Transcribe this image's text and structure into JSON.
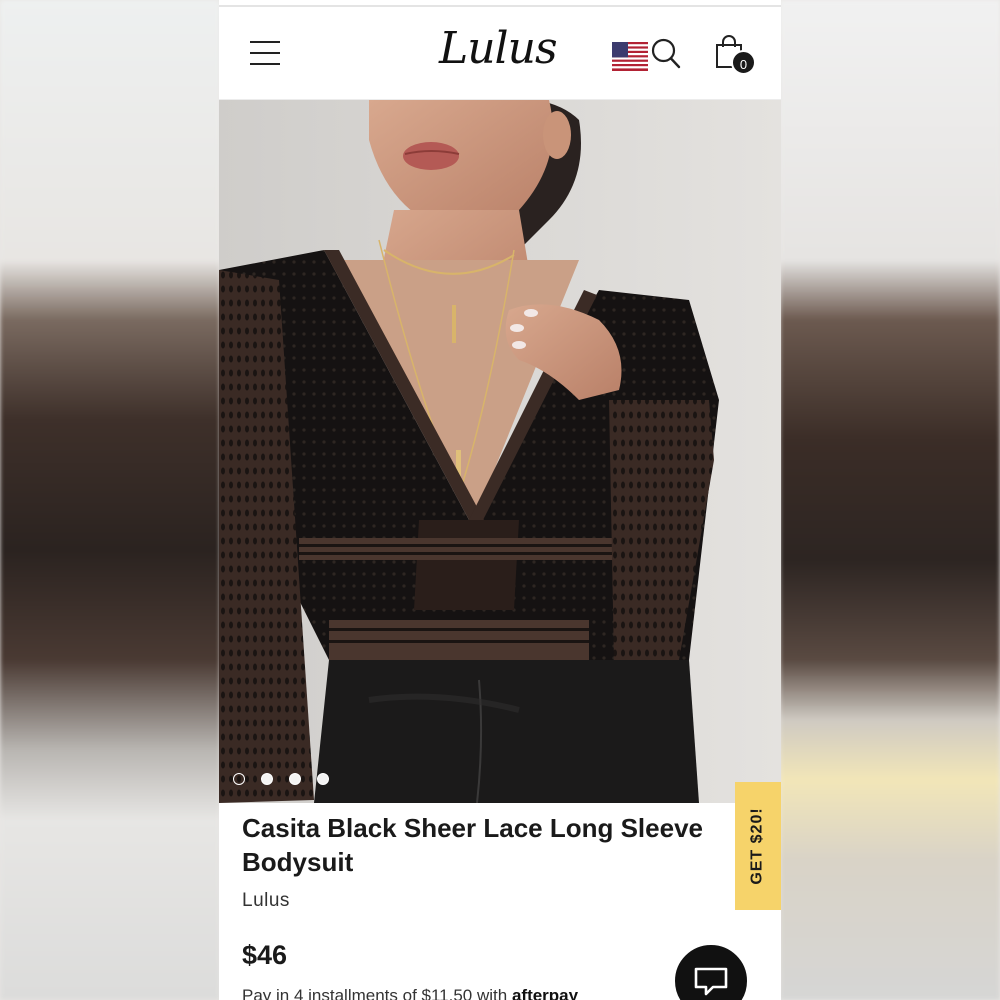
{
  "header": {
    "logo_text": "Lulus",
    "cart_count": "0"
  },
  "icons": {
    "menu": "hamburger-menu-icon",
    "flag": "us-flag-icon",
    "search": "search-icon",
    "bag": "shopping-bag-icon",
    "chat": "chat-icon"
  },
  "carousel": {
    "image_count": 4,
    "active_index": 0
  },
  "product": {
    "title_line1": "Casita Black Sheer Lace Long Sleeve",
    "title_line2": "Bodysuit",
    "brand": "Lulus",
    "price": "$46",
    "installments_text": "Pay in 4 installments of $11.50 with",
    "installments_provider": "afterpay"
  },
  "promo": {
    "label": "GET $20!"
  },
  "colors": {
    "promo_bg": "#f6d36a",
    "chat_bg": "#111111",
    "text_primary": "#1a1a1a"
  }
}
